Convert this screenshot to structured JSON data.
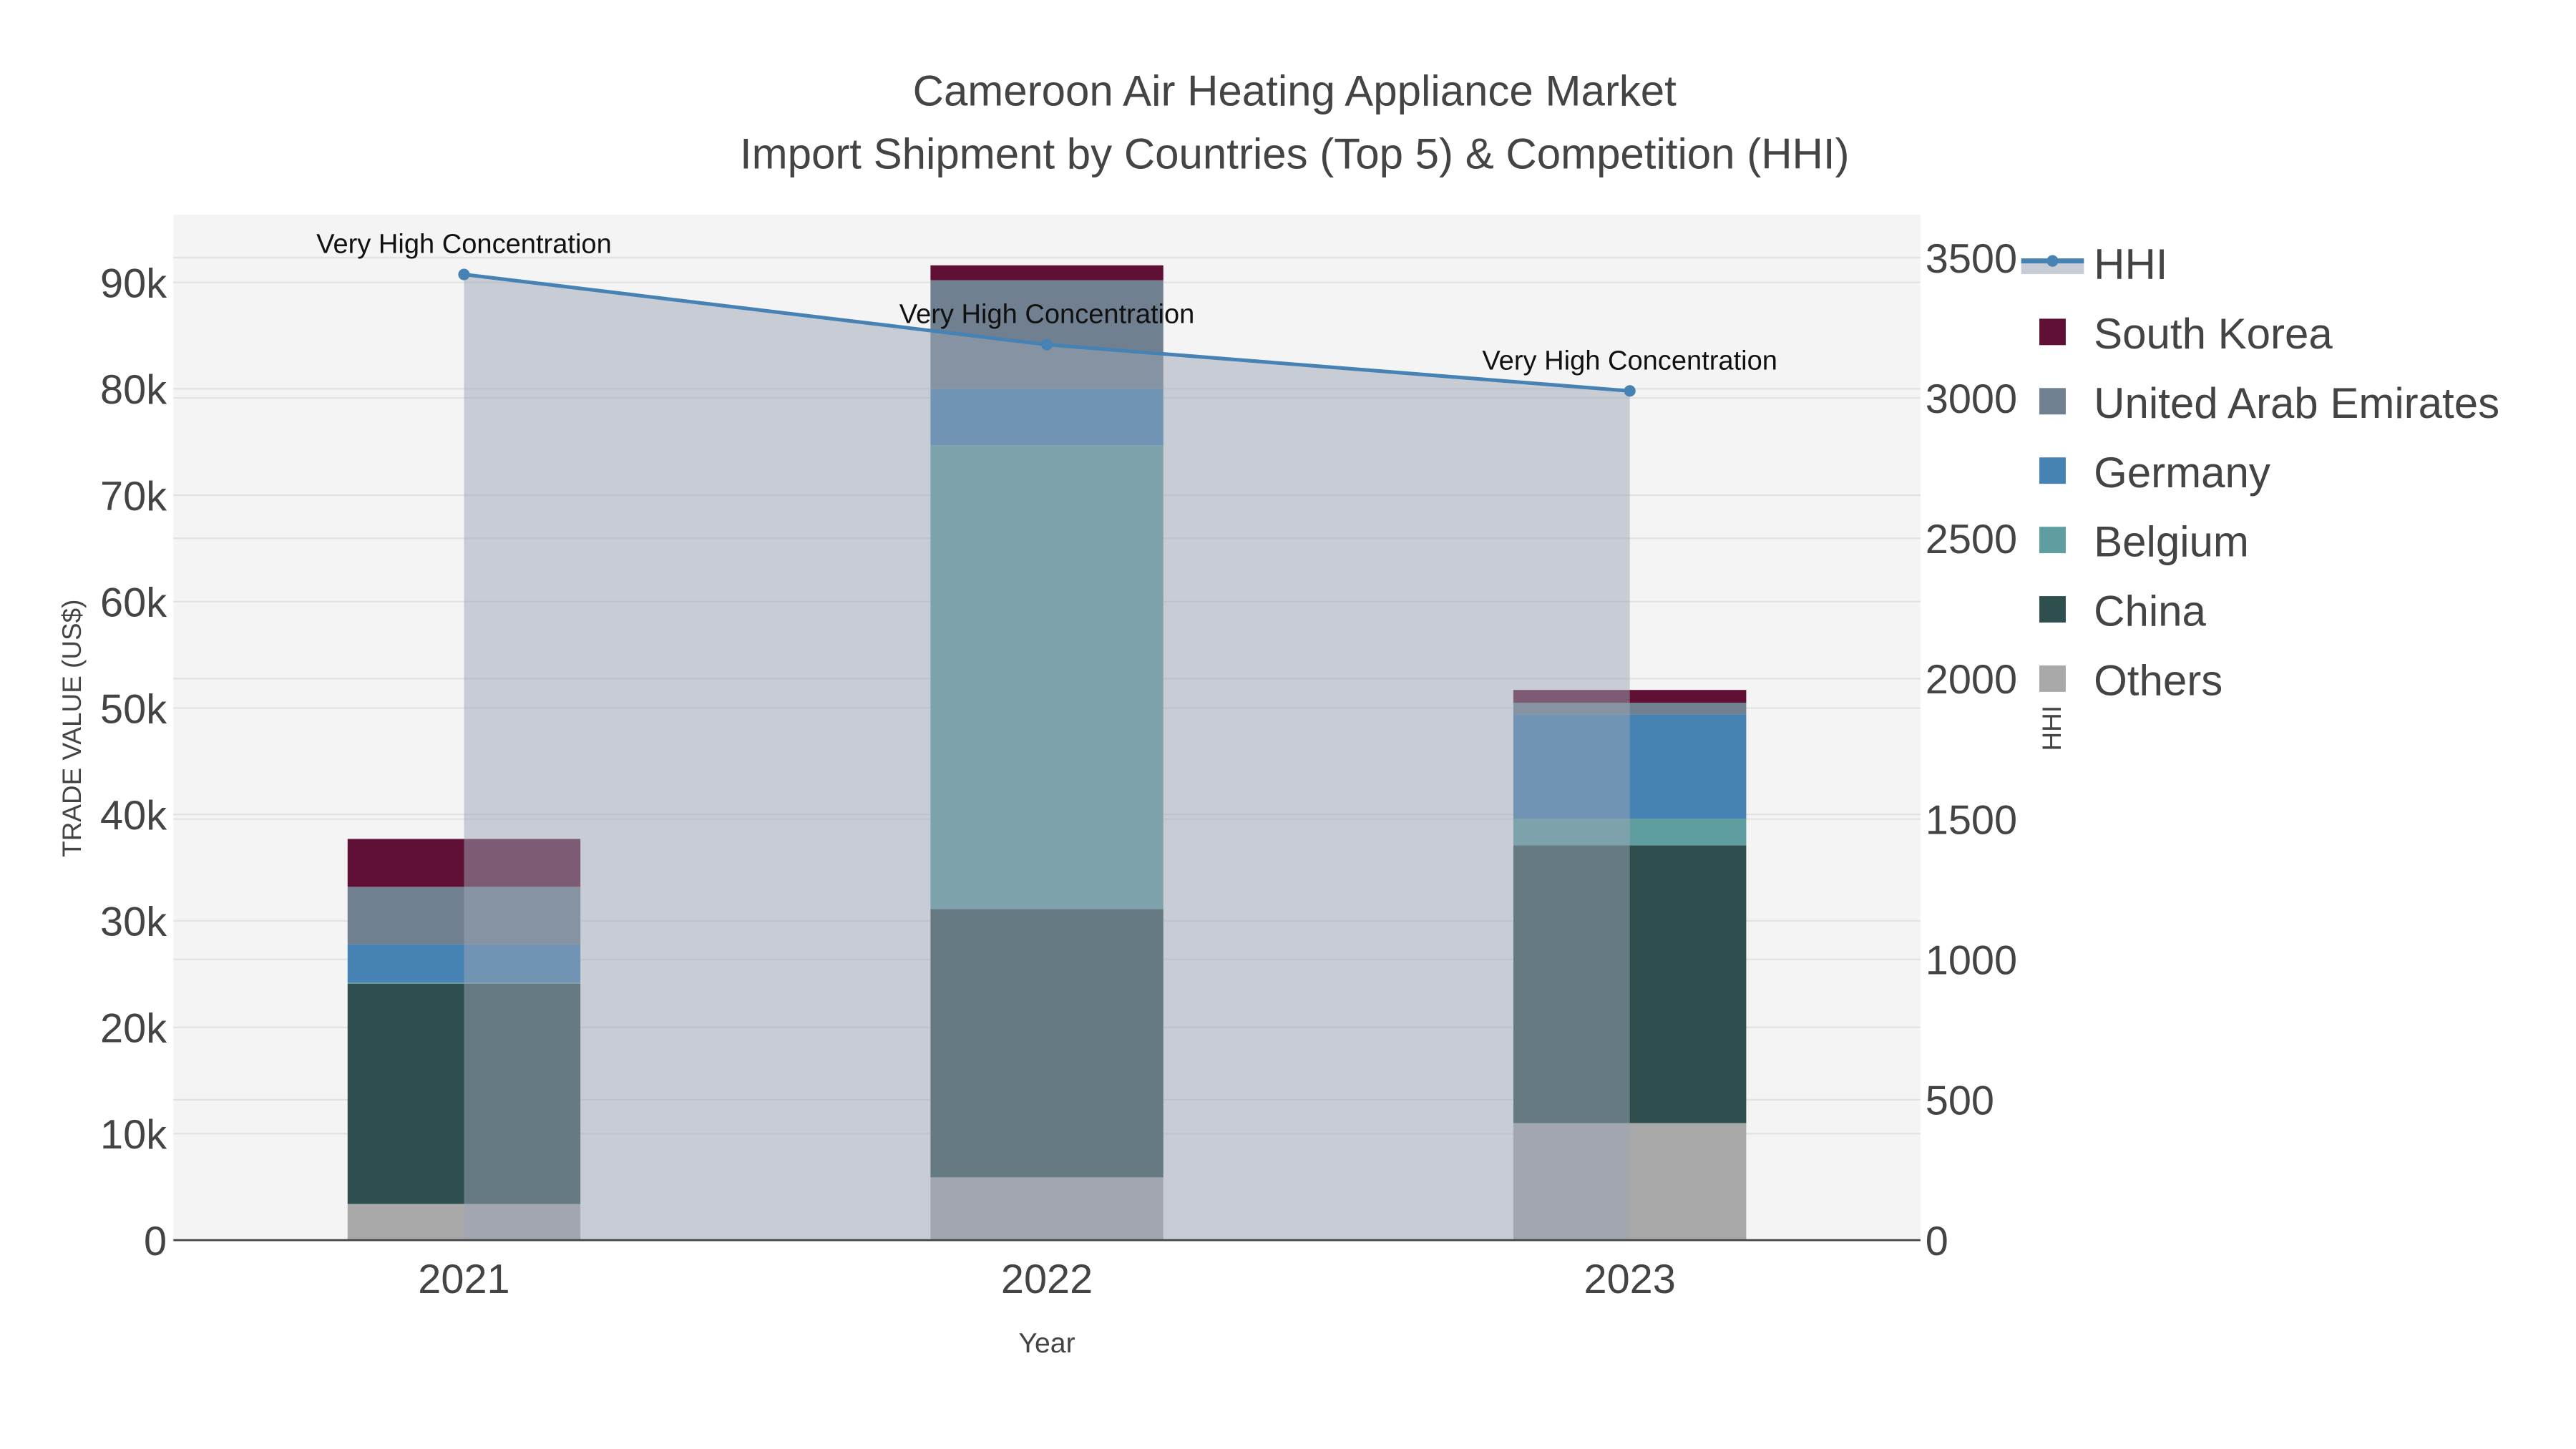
{
  "chart_data": {
    "type": "bar",
    "title_line1": "Cameroon Air Heating Appliance Market",
    "title_line2": "Import Shipment by Countries (Top 5) & Competition (HHI)",
    "xlabel": "Year",
    "ylabel": "TRADE VALUE (US$)",
    "y2label": "HHI",
    "categories": [
      "2021",
      "2022",
      "2023"
    ],
    "ylim": [
      0,
      96000
    ],
    "y2lim": [
      0,
      3720
    ],
    "yticks": [
      0,
      10000,
      20000,
      30000,
      40000,
      50000,
      60000,
      70000,
      80000,
      90000
    ],
    "ytick_labels": [
      "0",
      "10k",
      "20k",
      "30k",
      "40k",
      "50k",
      "60k",
      "70k",
      "80k",
      "90k"
    ],
    "y2ticks": [
      0,
      500,
      1000,
      1500,
      2000,
      2500,
      3000,
      3500
    ],
    "y2tick_labels": [
      "0",
      "500",
      "1000",
      "1500",
      "2000",
      "2500",
      "3000",
      "3500"
    ],
    "series": [
      {
        "name": "Others",
        "color": "#a9a9a9",
        "values": [
          3400,
          5900,
          11000
        ]
      },
      {
        "name": "China",
        "color": "#2f4f4f",
        "values": [
          20700,
          25200,
          26100
        ]
      },
      {
        "name": "Belgium",
        "color": "#5f9ea0",
        "values": [
          100,
          43600,
          2500
        ]
      },
      {
        "name": "Germany",
        "color": "#4682b4",
        "values": [
          3600,
          5300,
          9800
        ]
      },
      {
        "name": "United Arab Emirates",
        "color": "#708090",
        "values": [
          5400,
          10200,
          1100
        ]
      },
      {
        "name": "South Korea",
        "color": "#601035",
        "values": [
          4500,
          1400,
          1200
        ]
      }
    ],
    "hhi": {
      "name": "HHI",
      "color": "#4682b4",
      "values": [
        3440,
        3190,
        3025
      ],
      "annotations": [
        "Very High Concentration",
        "Very High Concentration",
        "Very High Concentration"
      ]
    },
    "legend_order": [
      "HHI",
      "South Korea",
      "United Arab Emirates",
      "Germany",
      "Belgium",
      "China",
      "Others"
    ],
    "legend_position": "right",
    "grid": true
  }
}
